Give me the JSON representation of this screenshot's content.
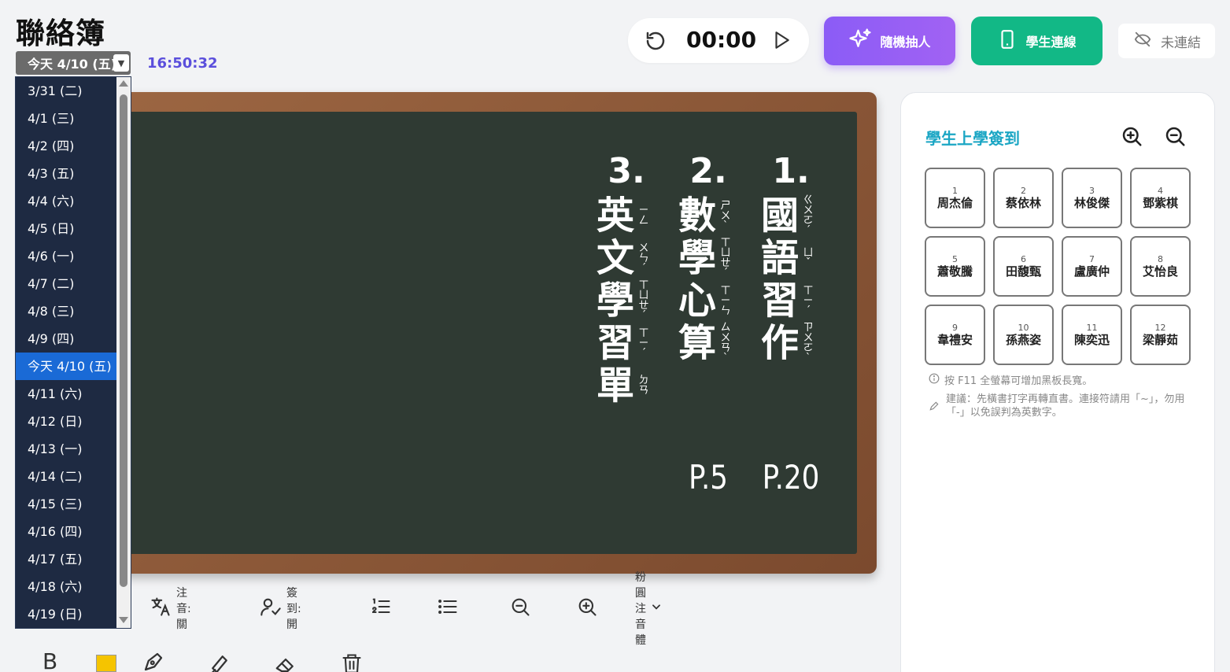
{
  "app": {
    "title": "聯絡簿",
    "clock": "16:50:32"
  },
  "date_select": {
    "value": "今天 4/10 (五)"
  },
  "dropdown": {
    "items": [
      "3/31 (二)",
      "4/1 (三)",
      "4/2 (四)",
      "4/3 (五)",
      "4/4 (六)",
      "4/5 (日)",
      "4/6 (一)",
      "4/7 (二)",
      "4/8 (三)",
      "4/9 (四)",
      "今天 4/10 (五)",
      "4/11 (六)",
      "4/12 (日)",
      "4/13 (一)",
      "4/14 (二)",
      "4/15 (三)",
      "4/16 (四)",
      "4/17 (五)",
      "4/18 (六)",
      "4/19 (日)"
    ],
    "selected_index": 10
  },
  "timer": {
    "time": "00:00"
  },
  "buttons": {
    "random": "隨機抽人",
    "connect": "學生連線",
    "status": "未連結"
  },
  "board": {
    "columns": [
      {
        "num": "1.",
        "chars": [
          {
            "h": "國",
            "z": "ㄍㄨㄛˊ"
          },
          {
            "h": "語",
            "z": "ㄩˇ"
          },
          {
            "h": "習",
            "z": "ㄒㄧˊ"
          },
          {
            "h": "作",
            "z": "ㄗㄨㄛˋ"
          }
        ],
        "page": "P.20"
      },
      {
        "num": "2.",
        "chars": [
          {
            "h": "數",
            "z": "ㄕㄨˋ"
          },
          {
            "h": "學",
            "z": "ㄒㄩㄝˊ"
          },
          {
            "h": "心",
            "z": "ㄒㄧㄣ"
          },
          {
            "h": "算",
            "z": "ㄙㄨㄢˋ"
          }
        ],
        "page": "P.5"
      },
      {
        "num": "3.",
        "chars": [
          {
            "h": "英",
            "z": "ㄧㄥ"
          },
          {
            "h": "文",
            "z": "ㄨㄣˊ"
          },
          {
            "h": "學",
            "z": "ㄒㄩㄝˊ"
          },
          {
            "h": "習",
            "z": "ㄒㄧˊ"
          },
          {
            "h": "單",
            "z": "ㄉㄢ"
          }
        ],
        "page": ""
      }
    ]
  },
  "toolbar": {
    "zhuyin": "注音:關",
    "signin": "簽到:開",
    "font": "粉圓注音體"
  },
  "panel": {
    "title": "學生上學簽到",
    "students": [
      {
        "n": "1",
        "name": "周杰倫"
      },
      {
        "n": "2",
        "name": "蔡依林"
      },
      {
        "n": "3",
        "name": "林俊傑"
      },
      {
        "n": "4",
        "name": "鄧紫棋"
      },
      {
        "n": "5",
        "name": "蕭敬騰"
      },
      {
        "n": "6",
        "name": "田馥甄"
      },
      {
        "n": "7",
        "name": "盧廣仲"
      },
      {
        "n": "8",
        "name": "艾怡良"
      },
      {
        "n": "9",
        "name": "韋禮安"
      },
      {
        "n": "10",
        "name": "孫燕姿"
      },
      {
        "n": "11",
        "name": "陳奕迅"
      },
      {
        "n": "12",
        "name": "梁靜茹"
      }
    ],
    "hint1": "按 F11 全螢幕可增加黑板長寬。",
    "hint2": "建議：先橫書打字再轉直書。連接符請用「~」，勿用「-」以免誤判為英數字。"
  },
  "colors": {
    "accent_purple": "#8b5cf6",
    "accent_green": "#12b886",
    "panel_title": "#1ba6c4",
    "board": "#2f3a33",
    "frame": "#8a5535"
  }
}
